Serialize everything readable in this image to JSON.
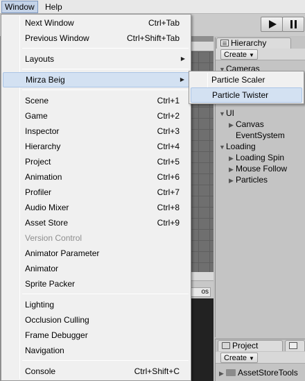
{
  "menubar": {
    "items": [
      "Window",
      "Help"
    ]
  },
  "toolbar": {
    "play_icon": "play-icon",
    "pause_icon": "pause-icon"
  },
  "game_view": {
    "tab_fragment": "os"
  },
  "hierarchy": {
    "tab_label": "Hierarchy",
    "create_label": "Create",
    "rows": [
      {
        "label": "Cameras",
        "expanded": true,
        "depth": 0
      },
      {
        "label": "UI",
        "expanded": true,
        "depth": 0
      },
      {
        "label": "Canvas",
        "expanded": false,
        "depth": 1
      },
      {
        "label": "EventSystem",
        "expanded": null,
        "depth": 1
      },
      {
        "label": "Loading",
        "expanded": true,
        "depth": 0
      },
      {
        "label": "Loading Spin",
        "expanded": false,
        "depth": 1
      },
      {
        "label": "Mouse Follow",
        "expanded": false,
        "depth": 1
      },
      {
        "label": "Particles",
        "expanded": false,
        "depth": 1
      }
    ]
  },
  "project": {
    "tab_label": "Project",
    "second_tab_fragment": "C",
    "create_label": "Create",
    "rows": [
      {
        "label": "AssetStoreTools"
      }
    ]
  },
  "window_menu": {
    "items": [
      {
        "label": "Next Window",
        "shortcut": "Ctrl+Tab"
      },
      {
        "label": "Previous Window",
        "shortcut": "Ctrl+Shift+Tab"
      },
      {
        "separator": true
      },
      {
        "label": "Layouts",
        "submenu": true
      },
      {
        "separator": true
      },
      {
        "label": "Mirza Beig",
        "submenu": true,
        "highlighted": true
      },
      {
        "separator": true
      },
      {
        "label": "Scene",
        "shortcut": "Ctrl+1"
      },
      {
        "label": "Game",
        "shortcut": "Ctrl+2"
      },
      {
        "label": "Inspector",
        "shortcut": "Ctrl+3"
      },
      {
        "label": "Hierarchy",
        "shortcut": "Ctrl+4"
      },
      {
        "label": "Project",
        "shortcut": "Ctrl+5"
      },
      {
        "label": "Animation",
        "shortcut": "Ctrl+6"
      },
      {
        "label": "Profiler",
        "shortcut": "Ctrl+7"
      },
      {
        "label": "Audio Mixer",
        "shortcut": "Ctrl+8"
      },
      {
        "label": "Asset Store",
        "shortcut": "Ctrl+9"
      },
      {
        "label": "Version Control",
        "disabled": true
      },
      {
        "label": "Animator Parameter"
      },
      {
        "label": "Animator"
      },
      {
        "label": "Sprite Packer"
      },
      {
        "separator": true
      },
      {
        "label": "Lighting"
      },
      {
        "label": "Occlusion Culling"
      },
      {
        "label": "Frame Debugger"
      },
      {
        "label": "Navigation"
      },
      {
        "separator": true
      },
      {
        "label": "Console",
        "shortcut": "Ctrl+Shift+C"
      }
    ]
  },
  "mirza_submenu": {
    "items": [
      {
        "label": "Particle Scaler"
      },
      {
        "label": "Particle Twister",
        "highlighted": true
      }
    ]
  },
  "colors": {
    "highlight": "#d3e1f2",
    "menu_background": "#f0f0f0",
    "disabled_text": "#8e8e8e"
  }
}
